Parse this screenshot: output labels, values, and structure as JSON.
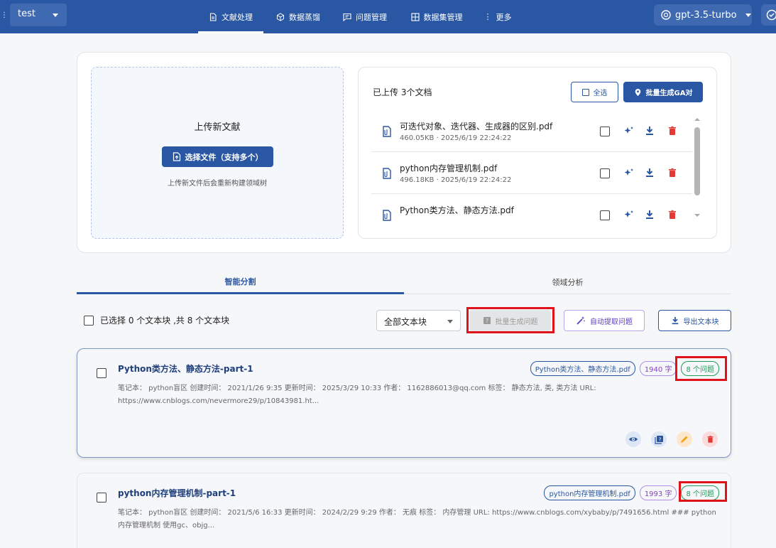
{
  "header": {
    "project": "test",
    "nav": [
      {
        "label": "文献处理",
        "icon": "document-icon",
        "active": true
      },
      {
        "label": "数据蒸馏",
        "icon": "cube-icon",
        "active": false
      },
      {
        "label": "问题管理",
        "icon": "chat-icon",
        "active": false
      },
      {
        "label": "数据集管理",
        "icon": "dataset-grid-icon",
        "active": false
      },
      {
        "label": "更多",
        "icon": "more-vert-icon",
        "active": false
      }
    ],
    "model": "gpt-3.5-turbo"
  },
  "upload": {
    "title": "上传新文献",
    "button": "选择文件（支持多个）",
    "hint": "上传新文件后会重新构建领域树"
  },
  "files": {
    "header": "已上传 3个文档",
    "select_all": "全选",
    "batch_generate": "批量生成GA对",
    "items": [
      {
        "name": "可迭代对象、迭代器、生成器的区别.pdf",
        "meta": "460.05KB · 2025/6/19 22:24:22"
      },
      {
        "name": "python内存管理机制.pdf",
        "meta": "496.18KB · 2025/6/19 22:24:22"
      },
      {
        "name": "Python类方法、静态方法.pdf",
        "meta": ""
      }
    ]
  },
  "tabs": {
    "split": "智能分割",
    "domain": "领域分析"
  },
  "toolbar": {
    "selection": "已选择 0 个文本块 ,共 8 个文本块",
    "filter": "全部文本块",
    "batch_questions": "批量生成问题",
    "auto_extract": "自动提取问题",
    "export": "导出文本块"
  },
  "chunks": [
    {
      "title": "Python类方法、静态方法-part-1",
      "source": "Python类方法、静态方法.pdf",
      "length": "1940 字",
      "questions": "8 个问题",
      "meta": "笔记本： python盲区 创建时间： 2021/1/26 9:35 更新时间： 2025/3/29 10:33 作者： 1162886013@qq.com 标签： 静态方法, 类, 类方法 URL: https://www.cnblogs.com/nevermore29/p/10843981.ht..."
    },
    {
      "title": "python内存管理机制-part-1",
      "source": "python内存管理机制.pdf",
      "length": "1993 字",
      "questions": "8 个问题",
      "meta": "笔记本： python盲区 创建时间： 2021/5/6 16:33 更新时间： 2024/2/29 9:29 作者： 无痕 标签： 内存管理 URL: https://www.cnblogs.com/xybaby/p/7491656.html ### python内存管理机制 使用gc、objg..."
    }
  ],
  "colors": {
    "primary": "#2a57a3",
    "danger": "#e53935",
    "highlight": "#e0121a",
    "success": "#1e9e57"
  }
}
